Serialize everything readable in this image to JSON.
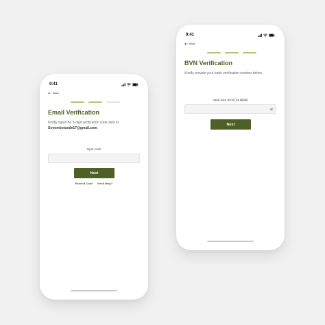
{
  "status_bar": {
    "time": "9:41"
  },
  "nav": {
    "back_label": "Back"
  },
  "colors": {
    "brand": "#4e6025",
    "step_active": "#b4c27e",
    "step_inactive": "#e3e3e3",
    "background": "#f1f1f1"
  },
  "email_screen": {
    "steps": [
      "active",
      "active",
      "inactive"
    ],
    "title": "Email Verification",
    "subtitle": "Kindly input the 5-digit verification code sent to",
    "email": "Soyombotunde17@gmail.com",
    "email_suffix": ".",
    "input_label": "Input code",
    "input_value": "",
    "next_label": "Next",
    "resend_label": "Resend Code",
    "help_label": "Need Help?"
  },
  "bvn_screen": {
    "steps": [
      "active",
      "active",
      "active"
    ],
    "title": "BVN Verification",
    "subtitle": "Kindly provide your bank verification number below.",
    "input_label": "Input your BVN (11 digits)",
    "input_value": "",
    "visibility_icon": "eye-off-icon",
    "next_label": "Next"
  }
}
